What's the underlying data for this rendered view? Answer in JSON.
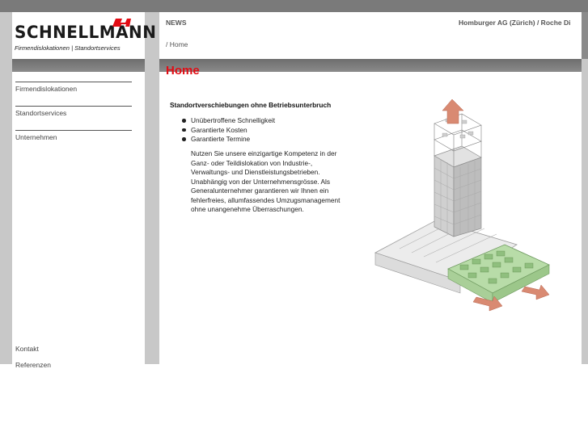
{
  "brand": {
    "name": "SCHNELLMANN",
    "tagline": "Firmendislokationen | Standortservices",
    "color": "#e20c14"
  },
  "nav": {
    "items": [
      {
        "label": "Firmendislokationen"
      },
      {
        "label": "Standortservices"
      },
      {
        "label": "Unternehmen"
      }
    ],
    "bottom": [
      {
        "label": "Kontakt"
      },
      {
        "label": "Referenzen"
      }
    ]
  },
  "header": {
    "news_label": "NEWS",
    "ticker": "Homburger AG (Zürich) / Roche Di"
  },
  "breadcrumb": "/ Home",
  "page": {
    "title": "Home",
    "subheading": "Standortverschiebungen ohne Betriebsunterbruch",
    "bullets": [
      "Unübertroffene Schnelligkeit",
      "Garantierte Kosten",
      "Garantierte Termine"
    ],
    "body_lines": [
      "Nutzen Sie unsere einzigartige Kompetenz in der",
      "Ganz- oder Teildislokation von Industrie-,",
      "Verwaltungs- und Dienstleistungsbetrieben.",
      "Unabhängig von der Unternehmensgrösse. Als",
      "Generalunternehmer garantieren wir Ihnen ein",
      "fehlerfreies, allumfassendes Umzugsmanagement",
      "ohne unangenehme Überraschungen."
    ]
  },
  "illustration": {
    "icon": "building-relocation-illustration",
    "arrow_color": "#d98a72",
    "floor_color": "#9ccc8c"
  }
}
